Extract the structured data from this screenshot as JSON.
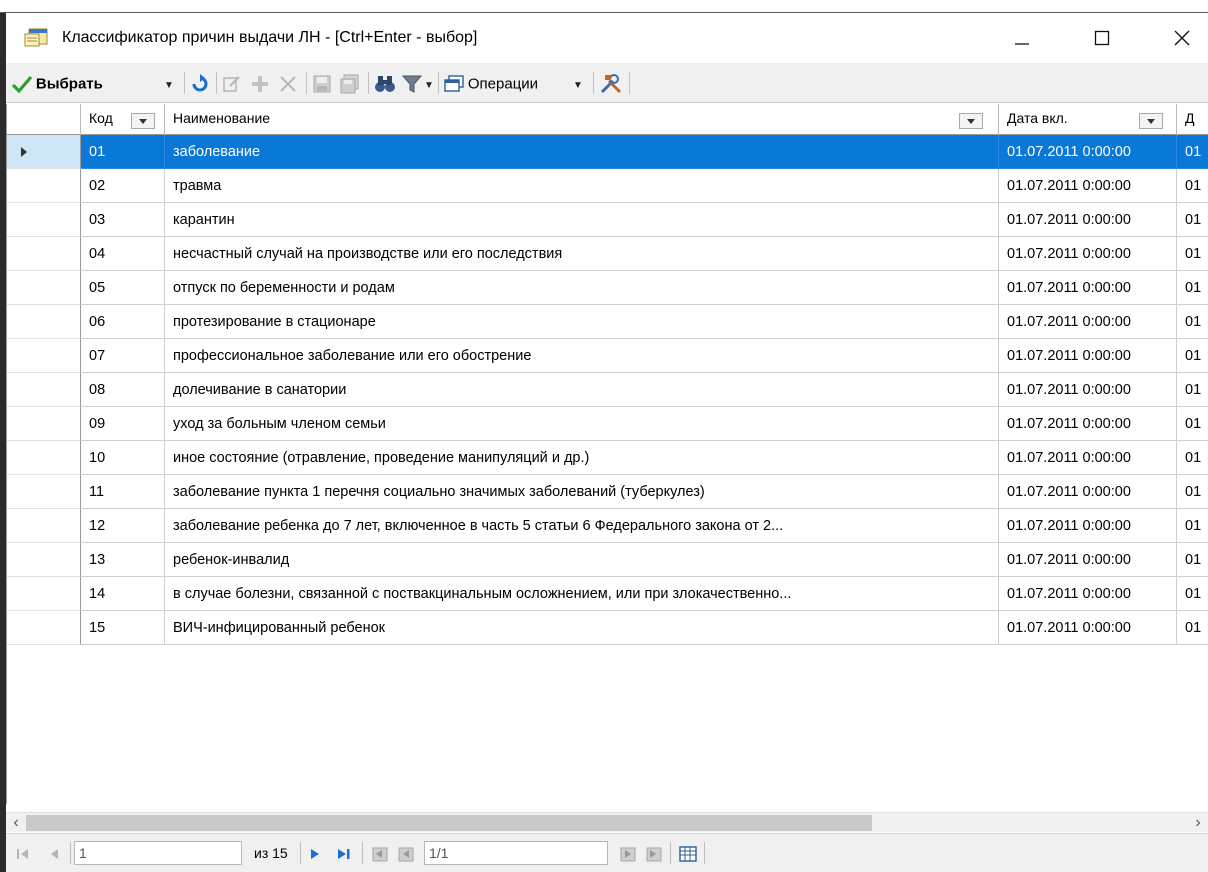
{
  "window": {
    "title": "Классификатор причин выдачи ЛН - [Ctrl+Enter - выбор]"
  },
  "toolbar": {
    "select_label": "Выбрать",
    "operations_label": "Операции"
  },
  "grid": {
    "columns": [
      {
        "label": "Код"
      },
      {
        "label": "Наименование"
      },
      {
        "label": "Дата вкл."
      },
      {
        "label": "Д"
      }
    ],
    "selected_row": 0,
    "rows": [
      {
        "code": "01",
        "name": "заболевание",
        "date": "01.07.2011 0:00:00",
        "extra": "01"
      },
      {
        "code": "02",
        "name": "травма",
        "date": "01.07.2011 0:00:00",
        "extra": "01"
      },
      {
        "code": "03",
        "name": "карантин",
        "date": "01.07.2011 0:00:00",
        "extra": "01"
      },
      {
        "code": "04",
        "name": "несчастный случай на производстве или его последствия",
        "date": "01.07.2011 0:00:00",
        "extra": "01"
      },
      {
        "code": "05",
        "name": "отпуск по беременности и родам",
        "date": "01.07.2011 0:00:00",
        "extra": "01"
      },
      {
        "code": "06",
        "name": "протезирование в стационаре",
        "date": "01.07.2011 0:00:00",
        "extra": "01"
      },
      {
        "code": "07",
        "name": "профессиональное заболевание или его обострение",
        "date": "01.07.2011 0:00:00",
        "extra": "01"
      },
      {
        "code": "08",
        "name": "долечивание в санатории",
        "date": "01.07.2011 0:00:00",
        "extra": "01"
      },
      {
        "code": "09",
        "name": "уход за больным членом семьи",
        "date": "01.07.2011 0:00:00",
        "extra": "01"
      },
      {
        "code": "10",
        "name": "иное состояние (отравление, проведение манипуляций и др.)",
        "date": "01.07.2011 0:00:00",
        "extra": "01"
      },
      {
        "code": "11",
        "name": "заболевание пункта 1 перечня социально значимых заболеваний (туберкулез)",
        "date": "01.07.2011 0:00:00",
        "extra": "01"
      },
      {
        "code": "12",
        "name": "заболевание ребенка до 7 лет, включенное в часть 5 статьи 6 Федерального закона от 2...",
        "date": "01.07.2011 0:00:00",
        "extra": "01"
      },
      {
        "code": "13",
        "name": "ребенок-инвалид",
        "date": "01.07.2011 0:00:00",
        "extra": "01"
      },
      {
        "code": "14",
        "name": "в случае болезни, связанной с поствакцинальным осложнением, или при злокачественно...",
        "date": "01.07.2011 0:00:00",
        "extra": "01"
      },
      {
        "code": "15",
        "name": "ВИЧ-инфицированный ребенок",
        "date": "01.07.2011 0:00:00",
        "extra": "01"
      }
    ]
  },
  "navigator": {
    "record_value": "1",
    "record_total": "из 15",
    "page_value": "1/1"
  },
  "colors": {
    "selection": "#0a78d7",
    "toolbar_bg": "#f0f0f0",
    "accent_green": "#2aa12a",
    "accent_blue": "#1a6fd0"
  },
  "icons": {
    "window": "form-window-icon",
    "select": "check-icon",
    "refresh": "refresh-icon",
    "edit": "edit-icon",
    "add": "add-icon",
    "delete": "delete-icon",
    "save": "save-icon",
    "save_all": "save-all-icon",
    "find": "binoculars-icon",
    "filter": "filter-icon",
    "operations": "copy-window-icon",
    "tools": "tools-icon"
  }
}
